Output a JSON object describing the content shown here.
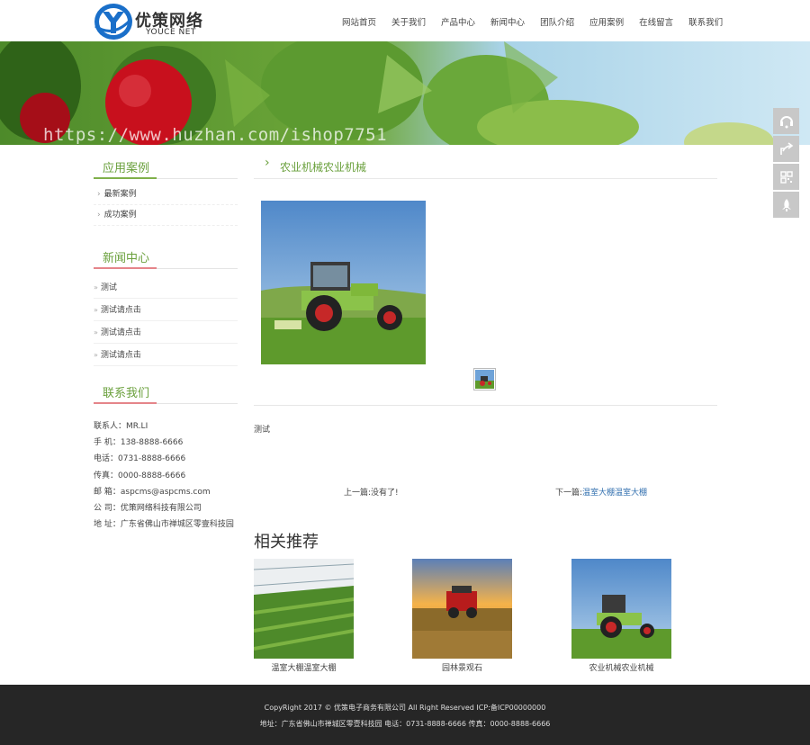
{
  "header": {
    "logo_cn": "优策网络",
    "logo_en": "YOUCE NET",
    "nav": [
      "网站首页",
      "关于我们",
      "产品中心",
      "新闻中心",
      "团队介绍",
      "应用案例",
      "在线留言",
      "联系我们"
    ]
  },
  "banner": {
    "watermark": "https://www.huzhan.com/ishop7751"
  },
  "toolbar": {
    "icons": [
      "headset-icon",
      "share-icon",
      "qrcode-icon",
      "rocket-icon"
    ]
  },
  "sidebar": {
    "cases_title": "应用案例",
    "cases": [
      "最新案例",
      "成功案例"
    ],
    "news_title": "新闻中心",
    "news": [
      "测试",
      "测试请点击",
      "测试请点击",
      "测试请点击"
    ],
    "contact_title": "联系我们",
    "contact": [
      "联系人：MR.LI",
      "手 机：138-8888-6666",
      "电话：0731-8888-6666",
      "传真：0000-8888-6666",
      "邮 箱：aspcms@aspcms.com",
      "公 司：优策网络科技有限公司",
      "地 址：广东省佛山市禅城区零壹科技园"
    ]
  },
  "main": {
    "title": "农业机械农业机械",
    "description": "测试",
    "prev_text": "上一篇:没有了!",
    "next_prefix": "下一篇:",
    "next_link": "温室大棚温室大棚",
    "related_title": "相关推荐",
    "related": [
      {
        "caption": "温室大棚温室大棚"
      },
      {
        "caption": "园林景观石"
      },
      {
        "caption": "农业机械农业机械"
      }
    ]
  },
  "footer": {
    "line1": "CopyRight 2017 © 优策电子商务有限公司 All Right Reserved ICP:备ICP00000000",
    "line2": "地址：广东省佛山市禅城区零壹科技园  电话：0731-8888-6666  传真：0000-8888-6666"
  },
  "colors": {
    "accent_green": "#6aa03c",
    "link_blue": "#3572b0",
    "footer_bg": "#262626"
  }
}
